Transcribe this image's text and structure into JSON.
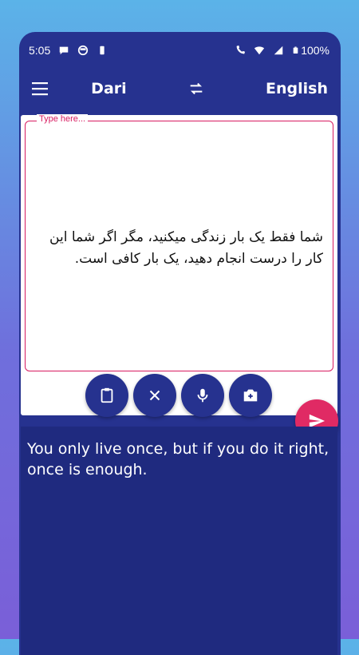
{
  "status_bar": {
    "time": "5:05",
    "battery": "100%"
  },
  "toolbar": {
    "source_lang": "Dari",
    "target_lang": "English"
  },
  "input": {
    "placeholder_label": "Type here...",
    "text": "شما فقط یک بار زندگی میکنید، مگر اگر شما این کار را درست انجام دهید، یک بار کافی است."
  },
  "output": {
    "text": "You only live once, but if you do it right, once is enough."
  },
  "colors": {
    "primary": "#26328f",
    "accent": "#e02a64",
    "output_bg": "#1f2a7f"
  }
}
